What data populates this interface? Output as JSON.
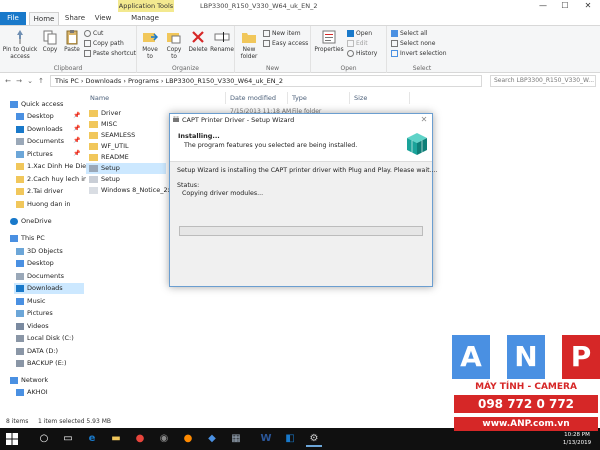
{
  "titlebar": {
    "app_tools": "Application Tools",
    "path_title": "LBP3300_R150_V330_W64_uk_EN_2",
    "minimize": "—",
    "maximize": "☐",
    "close": "✕"
  },
  "tabs": {
    "file": "File",
    "home": "Home",
    "share": "Share",
    "view": "View",
    "manage": "Manage"
  },
  "ribbon": {
    "clipboard": {
      "label": "Clipboard",
      "pin": "Pin to Quick access",
      "copy": "Copy",
      "paste": "Paste",
      "cut": "Cut",
      "copy_path": "Copy path",
      "paste_shortcut": "Paste shortcut"
    },
    "organize": {
      "label": "Organize",
      "move_to": "Move to",
      "copy_to": "Copy to",
      "delete": "Delete",
      "rename": "Rename"
    },
    "new": {
      "label": "New",
      "new_folder": "New folder",
      "new_item": "New item",
      "easy_access": "Easy access"
    },
    "open": {
      "label": "Open",
      "properties": "Properties",
      "open": "Open",
      "edit": "Edit",
      "history": "History"
    },
    "select": {
      "label": "Select",
      "select_all": "Select all",
      "select_none": "Select none",
      "invert": "Invert selection"
    }
  },
  "address": {
    "back": "←",
    "forward": "→",
    "up": "↑",
    "dropdown": "⌄",
    "path": [
      "This PC",
      "Downloads",
      "Programs",
      "LBP3300_R150_V330_W64_uk_EN_2"
    ],
    "search_placeholder": "Search LBP3300_R150_V330_W..."
  },
  "nav": {
    "quick_access": "Quick access",
    "items": [
      "Desktop",
      "Downloads",
      "Documents",
      "Pictures",
      "1.Xac Dinh He Dieu",
      "2.Cach huy lech in",
      "2.Tai driver",
      "Huong dan in"
    ],
    "onedrive": "OneDrive",
    "this_pc": "This PC",
    "pc_items": [
      "3D Objects",
      "Desktop",
      "Documents",
      "Downloads",
      "Music",
      "Pictures",
      "Videos",
      "Local Disk (C:)",
      "DATA (D:)",
      "BACKUP (E:)"
    ],
    "network": "Network",
    "network_items": [
      "AKHOI"
    ]
  },
  "files": {
    "headers": {
      "name": "Name",
      "date": "Date modified",
      "type": "Type",
      "size": "Size"
    },
    "rows": [
      "Driver",
      "MISC",
      "SEAMLESS",
      "WF_UTIL",
      "README",
      "Setup",
      "Setup",
      "Windows 8_Notice_2x"
    ],
    "hint_date": "7/15/2013 11:18 AM",
    "hint_type": "File folder"
  },
  "status": {
    "items": "8 items",
    "selected": "1 item selected  5.93 MB"
  },
  "dialog": {
    "title": "CAPT Printer Driver - Setup Wizard",
    "close": "✕",
    "heading": "Installing...",
    "subheading": "The program features you selected are being installed.",
    "message": "Setup Wizard is installing the CAPT printer driver with Plug and Play. Please wait....",
    "status_label": "Status:",
    "status_value": "Copying driver modules...",
    "progress": 0.0
  },
  "taskbar": {
    "time": "10:28 PM",
    "date": "1/13/2019"
  },
  "watermark": {
    "letters": [
      "A",
      "N",
      "P"
    ],
    "tagline": "MÁY TÍNH - CAMERA",
    "phone": "098 772 0 772",
    "website": "www.ANP.com.vn"
  },
  "colors": {
    "accent": "#1979ca",
    "selection": "#cce8ff",
    "anp_blue": "#4a90e2",
    "anp_red": "#d62727",
    "progress": "#06b025"
  }
}
